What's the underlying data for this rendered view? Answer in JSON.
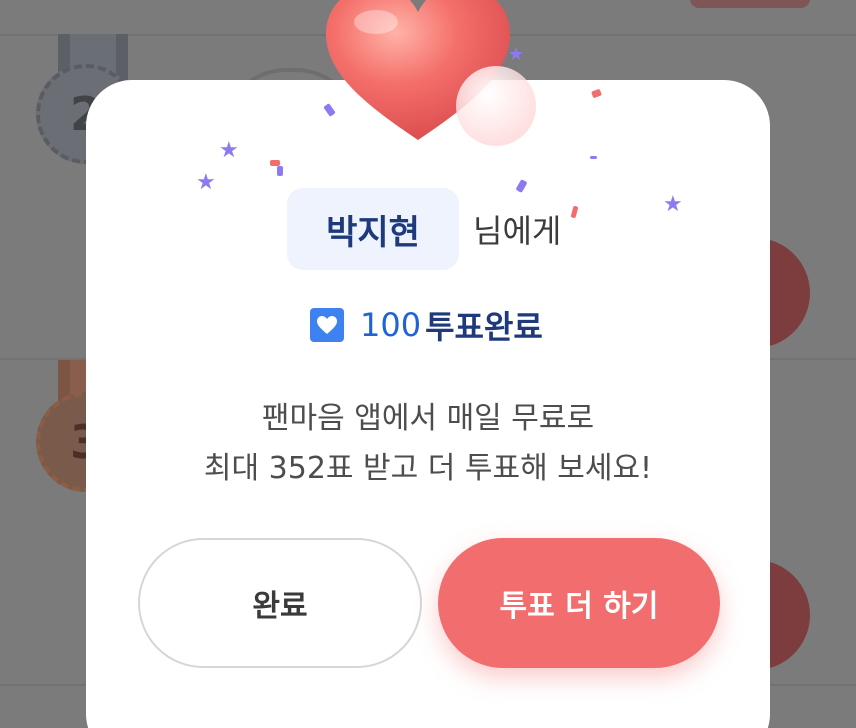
{
  "dialog": {
    "recipient_name": "박지현",
    "recipient_suffix": "님에게",
    "vote_count": "100",
    "vote_status": "투표완료",
    "message_line1": "팬마음 앱에서 매일 무료로",
    "message_line2": "최대 352표 받고 더 투표해 보세요!",
    "done_button_label": "완료",
    "vote_more_button_label": "투표 더 하기"
  },
  "background": {
    "medal_silver_rank": "2",
    "medal_bronze_rank": "3"
  },
  "icons": {
    "vote": "heart-icon",
    "celebration": "heart-balloon-icon"
  },
  "colors": {
    "accent": "#f26d6d",
    "vote_blue": "#3d82f0",
    "name_navy": "#1e3a7b",
    "chip_bg": "#eef3fd",
    "confetti_purple": "#8a7cf0"
  }
}
